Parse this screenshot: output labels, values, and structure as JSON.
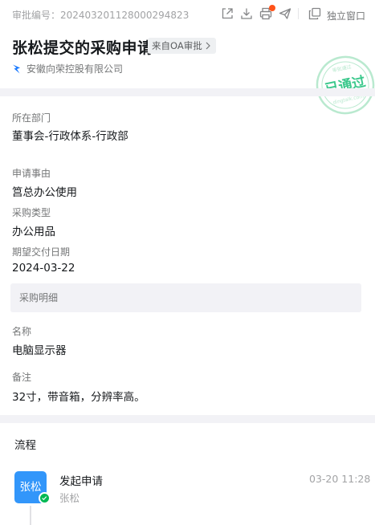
{
  "header": {
    "approval_no": "审批编号：202403201128000294823",
    "toolbar": {
      "icons": [
        "share-icon",
        "download-icon",
        "print-icon",
        "send-icon",
        "open-window-icon"
      ],
      "window_label": "独立窗口",
      "badge_color": "#ff5219"
    },
    "title": "张松提交的采购申请",
    "source_tag": "来自OA审批",
    "company": "安徽向荣控股有限公司"
  },
  "stamp": {
    "main_text": "已通过",
    "top_text": "审批通过",
    "bottom_text": "dingtalk.com",
    "color": "#3bc88c"
  },
  "fields": [
    {
      "label": "所在部门",
      "value": "董事会-行政体系-行政部"
    },
    {
      "label": "申请事由",
      "value": "筥总办公使用"
    },
    {
      "label": "采购类型",
      "value": "办公用品"
    },
    {
      "label": "期望交付日期",
      "value": "2024-03-22"
    }
  ],
  "detail": {
    "section_label": "采购明细",
    "fields": [
      {
        "label": "名称",
        "value": "电脑显示器"
      },
      {
        "label": "备注",
        "value": "32寸，带音箱，分辨率高。"
      }
    ]
  },
  "flow": {
    "title": "流程",
    "steps": [
      {
        "avatar_text": "张松",
        "title": "发起申请",
        "user": "张松",
        "time": "03-20 11:28",
        "status": "approved"
      }
    ]
  }
}
